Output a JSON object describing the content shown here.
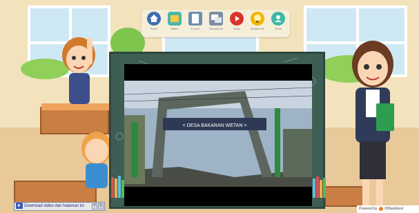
{
  "toolbar": {
    "items": [
      {
        "label": "Home",
        "icon": "home-icon",
        "color": "#3b6fb5"
      },
      {
        "label": "Materi",
        "icon": "book-icon",
        "color": "#4db6a9"
      },
      {
        "label": "E-book",
        "icon": "ebook-icon",
        "color": "#6a8fb2"
      },
      {
        "label": "Glossarium",
        "icon": "glossary-icon",
        "color": "#7d8ea3"
      },
      {
        "label": "Video",
        "icon": "video-icon",
        "color": "#d9342b"
      },
      {
        "label": "Simpan Ide",
        "icon": "lightbulb-icon",
        "color": "#f5b400"
      },
      {
        "label": "Profil",
        "icon": "profile-icon",
        "color": "#3fb8a4"
      }
    ]
  },
  "video": {
    "sign_text": "< DESA BAKARAN WETAN >"
  },
  "download_bar": {
    "label": "Download video dari halaman ini",
    "btn_help": "?",
    "btn_close": "X"
  },
  "footer": {
    "powered_prefix": "Powered by",
    "brand": "000webhost"
  },
  "colors": {
    "board": "#3e5e54",
    "video_bg": "#000000",
    "wall": "#f3e3bd",
    "floor": "#e9c99a"
  }
}
